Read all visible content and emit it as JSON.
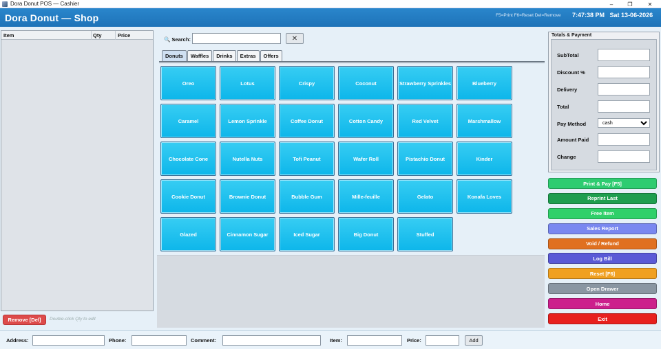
{
  "window": {
    "title": "Dora Donut POS — Cashier",
    "controls": [
      "–",
      "❐",
      "✕"
    ]
  },
  "header": {
    "brand": "Dora Donut  —  Shop",
    "shortcuts": "F5=Print  F6=Reset  Del=Remove",
    "time": "7:47:38 PM",
    "date": "Sat 13-06-2026"
  },
  "order": {
    "columns": {
      "item": "Item",
      "qty": "Qty",
      "price": "Price"
    },
    "remove_label": "Remove [Del]",
    "edit_hint": "Double-click Qty to edit"
  },
  "search": {
    "label": "🔍 Search:",
    "value": "",
    "clear": "✕"
  },
  "tabs": [
    {
      "label": "Donuts",
      "active": true
    },
    {
      "label": "Waffles",
      "active": false
    },
    {
      "label": "Drinks",
      "active": false
    },
    {
      "label": "Extras",
      "active": false
    },
    {
      "label": "Offers",
      "active": false
    }
  ],
  "products": [
    "Oreo",
    "Lotus",
    "Crispy",
    "Coconut",
    "Strawberry Sprinkles",
    "Blueberry",
    "Caramel",
    "Lemon Sprinkle",
    "Coffee Donut",
    "Cotton Candy",
    "Red Velvet",
    "Marshmallow",
    "Chocolate Cone",
    "Nutella Nuts",
    "Tofi Peanut",
    "Wafer Roll",
    "Pistachio Donut",
    "Kinder",
    "Cookie Donut",
    "Brownie Donut",
    "Bubble Gum",
    "Mille-feuille",
    "Gelato",
    "Konafa Loves",
    "Glazed",
    "Cinnamon Sugar",
    "Iced Sugar",
    "Big Donut",
    "Stuffed"
  ],
  "totals": {
    "caption": "Totals & Payment",
    "subtotal": {
      "label": "SubTotal",
      "value": ""
    },
    "discount": {
      "label": "Discount %",
      "value": ""
    },
    "delivery": {
      "label": "Delivery",
      "value": ""
    },
    "total": {
      "label": "Total",
      "value": ""
    },
    "pay_method": {
      "label": "Pay Method",
      "value": "cash"
    },
    "amount_paid": {
      "label": "Amount Paid",
      "value": ""
    },
    "change": {
      "label": "Change",
      "value": ""
    }
  },
  "actions": [
    {
      "name": "print-pay-button",
      "label": "Print & Pay [F5]",
      "color": "#2ecc71"
    },
    {
      "name": "reprint-last-button",
      "label": "Reprint Last",
      "color": "#1e9e4f"
    },
    {
      "name": "free-item-button",
      "label": "Free Item",
      "color": "#2fd06a"
    },
    {
      "name": "sales-report-button",
      "label": "Sales Report",
      "color": "#7a88f0"
    },
    {
      "name": "void-refund-button",
      "label": "Void / Refund",
      "color": "#e07020"
    },
    {
      "name": "log-bill-button",
      "label": "Log Bill",
      "color": "#5a5ad6"
    },
    {
      "name": "reset-button",
      "label": "Reset [F6]",
      "color": "#f0a020"
    },
    {
      "name": "open-drawer-button",
      "label": "Open Drawer",
      "color": "#8a96a2"
    },
    {
      "name": "home-button",
      "label": "Home",
      "color": "#cc1f8c"
    },
    {
      "name": "exit-button",
      "label": "Exit",
      "color": "#e8201e"
    }
  ],
  "bottom": {
    "address_label": "Address:",
    "phone_label": "Phone:",
    "comment_label": "Comment:",
    "item_label": "Item:",
    "price_label": "Price:",
    "add_label": "Add"
  },
  "colors": {
    "header": "#1e73b8",
    "product": "#0db6ea"
  }
}
